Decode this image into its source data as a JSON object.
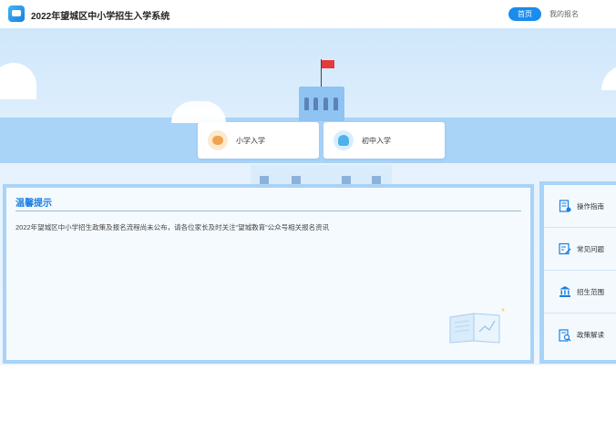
{
  "header": {
    "app_title": "2022年望城区中小学招生入学系统",
    "nav_home": "首页",
    "nav_my_registration": "我的报名"
  },
  "entries": [
    {
      "label": "小学入学",
      "icon": "primary-school-child-icon"
    },
    {
      "label": "初中入学",
      "icon": "middle-school-child-icon"
    }
  ],
  "notice": {
    "title": "温馨提示",
    "text": "2022年望城区中小学招生政策及报名流程尚未公布，请各位家长及时关注“望城教育”公众号相关报名资讯"
  },
  "side_menu": [
    {
      "label": "操作指南",
      "icon": "guide-document-icon"
    },
    {
      "label": "常见问题",
      "icon": "faq-edit-icon"
    },
    {
      "label": "招生范围",
      "icon": "bank-building-icon"
    },
    {
      "label": "政策解读",
      "icon": "policy-search-icon"
    }
  ],
  "colors": {
    "accent": "#1a8cf0",
    "title_blue": "#1a7fe0",
    "panel_frame": "#a9d3f7",
    "flag_red": "#e23b3b"
  }
}
